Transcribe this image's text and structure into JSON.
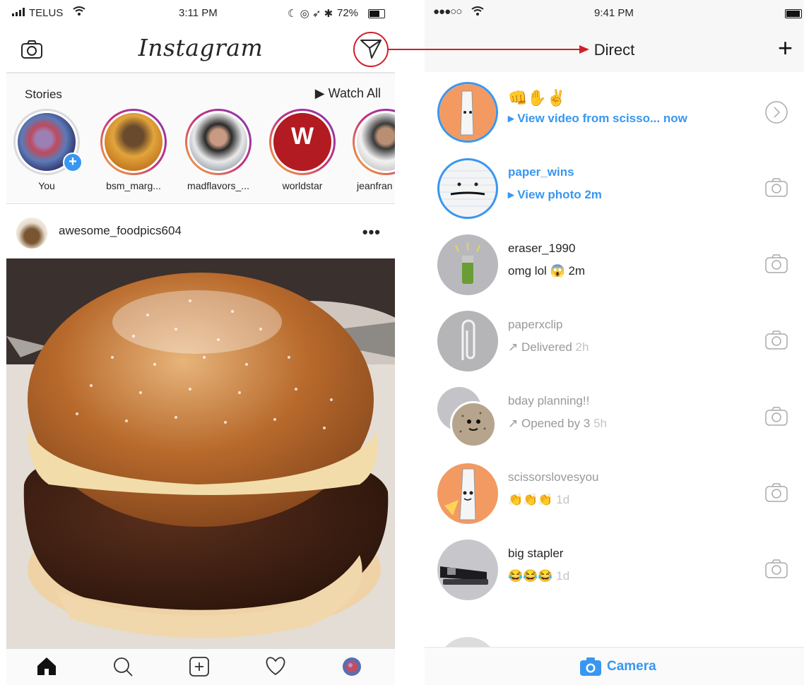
{
  "left": {
    "status": {
      "carrier": "TELUS",
      "time": "3:11 PM",
      "battery": "72%"
    },
    "header": {
      "logo": "Instagram"
    },
    "stories": {
      "title": "Stories",
      "watch_all": "▶ Watch All",
      "items": [
        {
          "label": "You"
        },
        {
          "label": "bsm_marg..."
        },
        {
          "label": "madflavors_..."
        },
        {
          "label": "worldstar"
        },
        {
          "label": "jeanfran"
        }
      ]
    },
    "post": {
      "username": "awesome_foodpics604",
      "more": "•••"
    }
  },
  "right": {
    "status": {
      "signal": "●●●○○",
      "time": "9:41 PM"
    },
    "header": {
      "title": "Direct",
      "new_label": "+"
    },
    "threads": [
      {
        "name": "👊✋✌",
        "sub": "▸ View video from scisso... now"
      },
      {
        "name": "paper_wins",
        "sub": "▸ View photo 2m"
      },
      {
        "name": "eraser_1990",
        "sub_text": "omg lol 😱",
        "sub_time": "2m"
      },
      {
        "name": "paperxclip",
        "sub_text": "↗ Delivered",
        "sub_time": "2h"
      },
      {
        "name": "bday planning!!",
        "sub_text": "↗ Opened by 3",
        "sub_time": "5h"
      },
      {
        "name": "scissorslovesyou",
        "sub_text": "👏👏👏",
        "sub_time": "1d"
      },
      {
        "name": "big stapler",
        "sub_text": "😂😂😂",
        "sub_time": "1d"
      }
    ],
    "footer": {
      "camera": "Camera"
    }
  },
  "colors": {
    "accent_blue": "#3897f0",
    "annotation_red": "#d0202a"
  }
}
